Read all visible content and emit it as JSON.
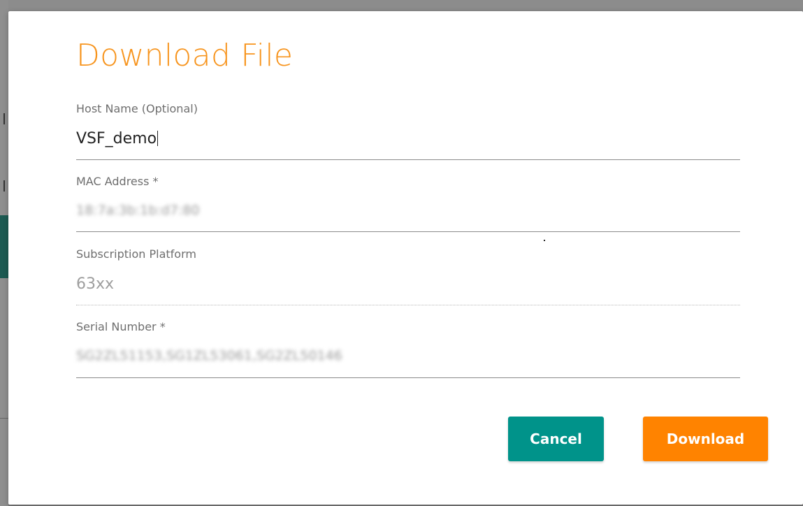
{
  "dialog": {
    "title": "Download File",
    "fields": [
      {
        "label": "Host Name (Optional)",
        "value": "VSF_demo",
        "state": "focused"
      },
      {
        "label": "MAC Address *",
        "value": "18:7a:3b:1b:d7:80",
        "state": "blurred"
      },
      {
        "label": "Subscription Platform",
        "value": "63xx",
        "state": "disabled"
      },
      {
        "label": "Serial Number *",
        "value": "SG2ZL51153,SG1ZL53061,SG2ZL50146",
        "state": "blurred"
      }
    ],
    "buttons": {
      "cancel": "Cancel",
      "download": "Download"
    }
  },
  "colors": {
    "title": "#f7941d",
    "cancel_button": "#00938a",
    "download_button": "#ff8300"
  }
}
